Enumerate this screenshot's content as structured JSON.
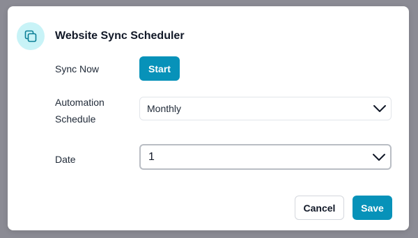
{
  "dialog": {
    "title": "Website Sync Scheduler",
    "icon": "copy-icon",
    "accent_color": "#0792b9",
    "icon_bg_color": "#c8f3f7"
  },
  "sync": {
    "label": "Sync Now",
    "button_label": "Start"
  },
  "schedule": {
    "label": "Automation Schedule",
    "selected": "Monthly"
  },
  "date": {
    "label": "Date",
    "selected": "1"
  },
  "footer": {
    "cancel_label": "Cancel",
    "save_label": "Save"
  }
}
